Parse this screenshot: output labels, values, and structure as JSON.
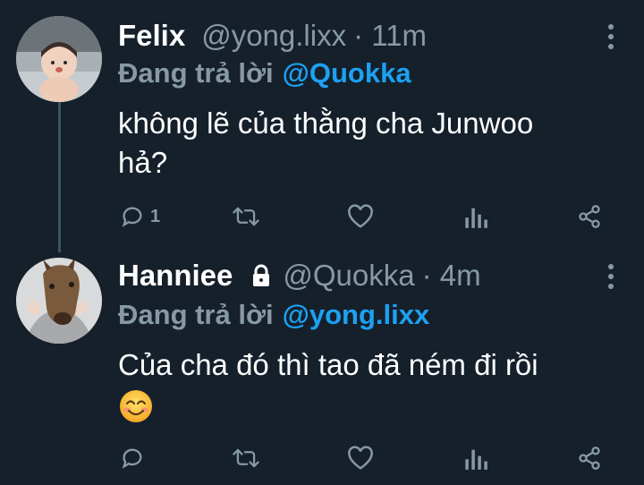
{
  "tweets": [
    {
      "name": "Felix",
      "handle": "@yong.lixx",
      "time": "· 11m",
      "reply_prefix": "Đang trả lời",
      "reply_to": "@Quokka",
      "body_line1": "không lẽ của thằng cha Junwoo",
      "body_line2": "hả?",
      "reply_count": "1",
      "avatar_icon": "avatar-baby-photo",
      "locked": false
    },
    {
      "name": "Hanniee",
      "handle": "@Quokka",
      "time": "· 4m",
      "reply_prefix": "Đang trả lời",
      "reply_to": "@yong.lixx",
      "body_line1": "Của cha đó thì tao đã ném đi rồi",
      "emoji": "smiling-face-emoji",
      "reply_count": "",
      "avatar_icon": "avatar-horse-mask-photo",
      "locked": true
    }
  ],
  "colors": {
    "background": "#15202b",
    "text": "#ffffff",
    "muted": "#8899a6",
    "link": "#1da1f2",
    "thread_line": "#3d5466"
  },
  "icons": [
    "reply-icon",
    "retweet-icon",
    "like-icon",
    "analytics-icon",
    "share-icon",
    "more-icon",
    "lock-icon"
  ]
}
